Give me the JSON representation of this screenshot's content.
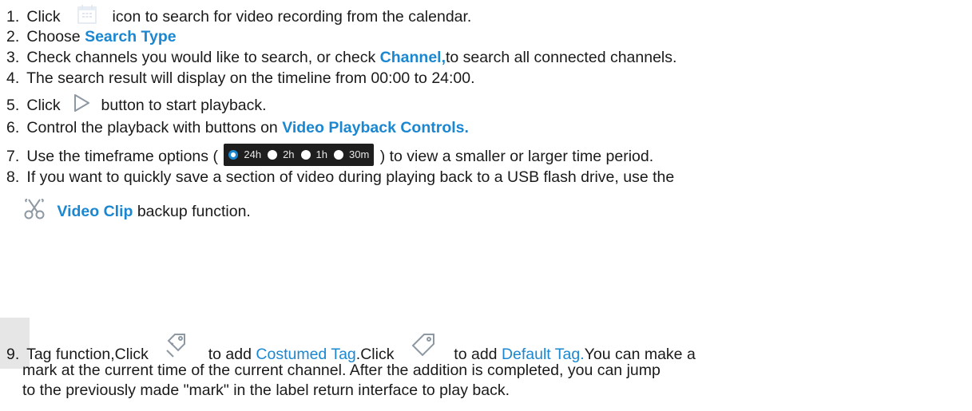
{
  "steps": [
    {
      "num": "1.",
      "a": "Click",
      "b": "icon to search for video recording from the calendar."
    },
    {
      "num": "2.",
      "a": "Choose ",
      "hl": "Search Type"
    },
    {
      "num": "3.",
      "a": "Check channels you would like to search, or check ",
      "hl": "Channel,",
      "b": "to search all connected channels."
    },
    {
      "num": "4.",
      "a": "The search result will display on the timeline from 00:00 to 24:00."
    },
    {
      "num": "5.",
      "a": "Click",
      "b": "button to start playback."
    },
    {
      "num": "6.",
      "a": "Control the playback with buttons on ",
      "hl": "Video Playback Controls."
    },
    {
      "num": "7.",
      "a": "Use the timeframe options (",
      "b": ") to view a smaller or larger time period."
    },
    {
      "num": "8.",
      "a": "If you want to quickly save a section of video during playing back to a USB flash drive, use the",
      "hl": "Video Clip",
      "b": " backup function."
    },
    {
      "num": "9.",
      "a": "Tag function,Click",
      "b": "to add ",
      "hl1": "Costumed Tag",
      "c": ".Click",
      "d": "to add ",
      "hl2": "Default Tag.",
      "e": "You can make a",
      "f": "mark at the current time of the current channel. After the addition is completed, you can jump",
      "g": "to the previously made \"mark\" in the label return interface to play back."
    }
  ],
  "timeframe_options": [
    "24h",
    "2h",
    "1h",
    "30m"
  ],
  "timeframe_selected": "24h",
  "icons": {
    "calendar": "calendar-icon",
    "play": "play-icon",
    "clip": "scissors-icon",
    "custom_tag": "add-tag-icon",
    "default_tag": "tag-icon"
  },
  "colors": {
    "highlight": "#1b87d1",
    "timeframe_bg": "#1e1e1e",
    "icon": "#9aa3ad"
  }
}
